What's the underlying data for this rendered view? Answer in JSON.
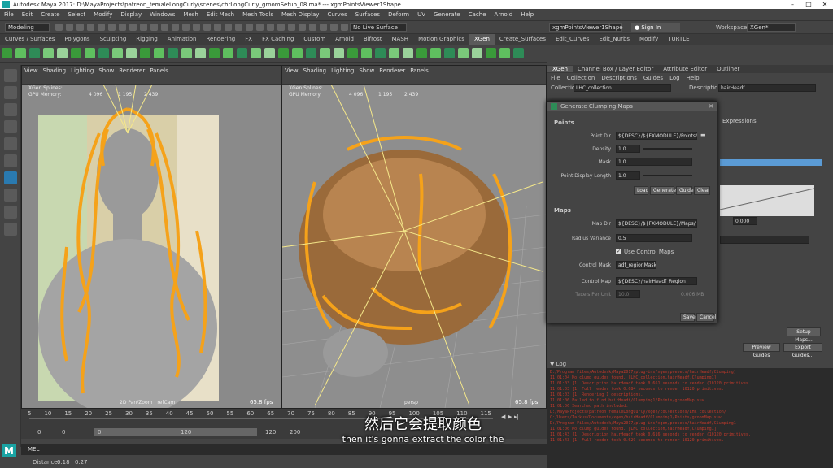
{
  "window": {
    "title": "Autodesk Maya 2017: D:\\MayaProjects\\patreon_femaleLongCurly\\scenes\\chrLongCurly_groomSetup_08.ma*  ---  xgmPointsViewer1Shape"
  },
  "menubar": [
    "File",
    "Edit",
    "Create",
    "Select",
    "Modify",
    "Display",
    "Windows",
    "Mesh",
    "Edit Mesh",
    "Mesh Tools",
    "Mesh Display",
    "Curves",
    "Surfaces",
    "Deform",
    "UV",
    "Generate",
    "Cache",
    "Arnold",
    "Help"
  ],
  "statusline": {
    "mode": "Modeling",
    "live_surface": "No Live Surface",
    "selected_object": "xgmPointsViewer1Shape",
    "sign_in": "Sign In",
    "workspace_label": "Workspace :",
    "workspace": "XGen*"
  },
  "shelf_tabs": [
    "Curves / Surfaces",
    "Polygons",
    "Sculpting",
    "Rigging",
    "Animation",
    "Rendering",
    "FX",
    "FX Caching",
    "Custom",
    "Arnold",
    "Bifrost",
    "MASH",
    "Motion Graphics",
    "XGen",
    "Create_Surfaces",
    "Edit_Curves",
    "Edit_Nurbs",
    "Modify",
    "TURTLE"
  ],
  "shelf_active_tab": "XGen",
  "viewport_menu": [
    "View",
    "Shading",
    "Lighting",
    "Show",
    "Renderer",
    "Panels"
  ],
  "viewport_left": {
    "hud_label1": "XGen Splines:",
    "hud_label2": "GPU Memory:",
    "hud_values1": [
      "4 096",
      "1 195",
      "2 439"
    ],
    "camera": "2D Pan/Zoom : refCam",
    "fps": "65.8 fps"
  },
  "viewport_right": {
    "hud_label1": "XGen Splines:",
    "hud_label2": "GPU Memory:",
    "hud_values1": [
      "4 096",
      "1 195",
      "2 439"
    ],
    "camera": "persp",
    "fps": "65.8 fps"
  },
  "timeslider": {
    "ticks": [
      "5",
      "10",
      "15",
      "20",
      "25",
      "30",
      "35",
      "40",
      "45",
      "50",
      "55",
      "60",
      "65",
      "70",
      "75",
      "80",
      "85",
      "90",
      "95",
      "100",
      "105",
      "110",
      "115"
    ],
    "start": "0",
    "current": "0",
    "range_start": "0",
    "range_end": "120",
    "end": "120",
    "end2": "200"
  },
  "cmdline": {
    "label": "MEL"
  },
  "helpline": {
    "left": "Distance:",
    "v1": "0.18",
    "v2": "0.27"
  },
  "subtitles": {
    "chinese": "然后它会提取颜色",
    "english": "then it's gonna extract the color the"
  },
  "right_panel": {
    "tabs": [
      "XGen",
      "Channel Box / Layer Editor",
      "Attribute Editor",
      "Outliner"
    ],
    "menu": [
      "File",
      "Collection",
      "Descriptions",
      "Guides",
      "Log",
      "Help"
    ],
    "collection_label": "Collection",
    "collection": "LHC_collection",
    "description_label": "Description",
    "description": "hairHeadf",
    "expressions_tab": "Expressions",
    "value_field": "0.000",
    "setup_maps": "Setup Maps...",
    "preview_guides": "Preview Guides",
    "export_guides": "Export Guides..."
  },
  "dialog": {
    "title": "Generate Clumping Maps",
    "points_section": "Points",
    "point_dir_label": "Point Dir",
    "point_dir": "${DESC}/${FXMODULE}/Points/",
    "density_label": "Density",
    "density": "1.0",
    "mask_label": "Mask",
    "mask": "1.0",
    "point_display_label": "Point Display Length",
    "point_display": "1.0",
    "btn_load": "Load",
    "btn_generate": "Generate",
    "btn_guide": "Guide",
    "btn_clear": "Clear",
    "maps_section": "Maps",
    "map_dir_label": "Map Dir",
    "map_dir": "${DESC}/${FXMODULE}/Maps/",
    "radius_variance_label": "Radius Variance",
    "radius_variance": "0.5",
    "use_control_maps": "Use Control Maps",
    "control_mask_label": "Control Mask",
    "control_mask": "adf_regionMask",
    "control_map_label": "Control Map",
    "control_map": "${DESC}/hairHeadf_Region",
    "texels_label": "Texels Per Unit",
    "texels": "10.0",
    "texels_mb": "0.006 MB",
    "btn_save": "Save",
    "btn_cancel": "Cancel"
  },
  "log": {
    "title": "Log",
    "lines": [
      "                    D:/Program Files/Autodesk/Maya2017/plug-ins/xgen/presets/hairHeadf/Clumping)",
      "11:01:04  No clump guides found. [LHC_collection,hairHeadf,Clumping1]",
      "11:01:03 [1] Description hairHeadf took 0.661 seconds to render (10120 primitives.",
      "11:01:03 [1] Full render took 0.684 seconds to render 10120 primitives.",
      "11:01:03 [1] Rendering 1 descriptions.",
      "11:01:06    Failed to find hairHeadf/Clumping1/Points/groomMap.xuv",
      "11:01:06    Searched path included:",
      "                    D:/MayaProjects/patreon_femaleLongCurly/xgen/collections/LHC_collection/",
      "                    C:/Users/Tarkus/Documents/xgen/hairHeadf/Clumping1/Points/groomMap.xuv",
      "                    D:/Program Files/Autodesk/Maya2017/plug-ins/xgen/presets/hairHeadf/Clumping1",
      "11:01:06  No clump guides found. [LHC_collection,hairHeadf,Clumping1]",
      "11:01:43 [1] Description hairHeadf took 0.616 seconds to render (10120 primitives.",
      "11:01:43 [1] Full render took 0.629 seconds to render 10120 primitives."
    ]
  },
  "colors": {
    "guides": "#f5a21a",
    "hair": "#9a6a3a",
    "selection": "#5b9bd5",
    "log_text": "#c0392b"
  }
}
